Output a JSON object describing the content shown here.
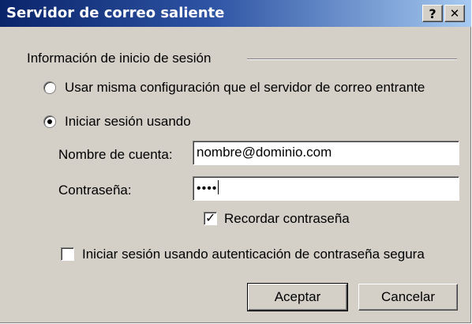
{
  "window": {
    "title": "Servidor de correo saliente",
    "help_label": "?",
    "close_label": "✕"
  },
  "group": {
    "label": "Información de inicio de sesión"
  },
  "options": {
    "same_config_label": "Usar misma configuración que el servidor de correo entrante",
    "same_config_selected": false,
    "login_using_label": "Iniciar sesión usando",
    "login_using_selected": true
  },
  "fields": {
    "account_label": "Nombre de cuenta:",
    "account_value": "nombre@dominio.com",
    "password_label": "Contraseña:",
    "password_value": "••••"
  },
  "remember": {
    "label": "Recordar contraseña",
    "checked": true,
    "mark": "✓"
  },
  "secure_auth": {
    "label": "Iniciar sesión usando autenticación de contraseña segura",
    "checked": false
  },
  "buttons": {
    "accept": "Aceptar",
    "cancel": "Cancelar"
  }
}
